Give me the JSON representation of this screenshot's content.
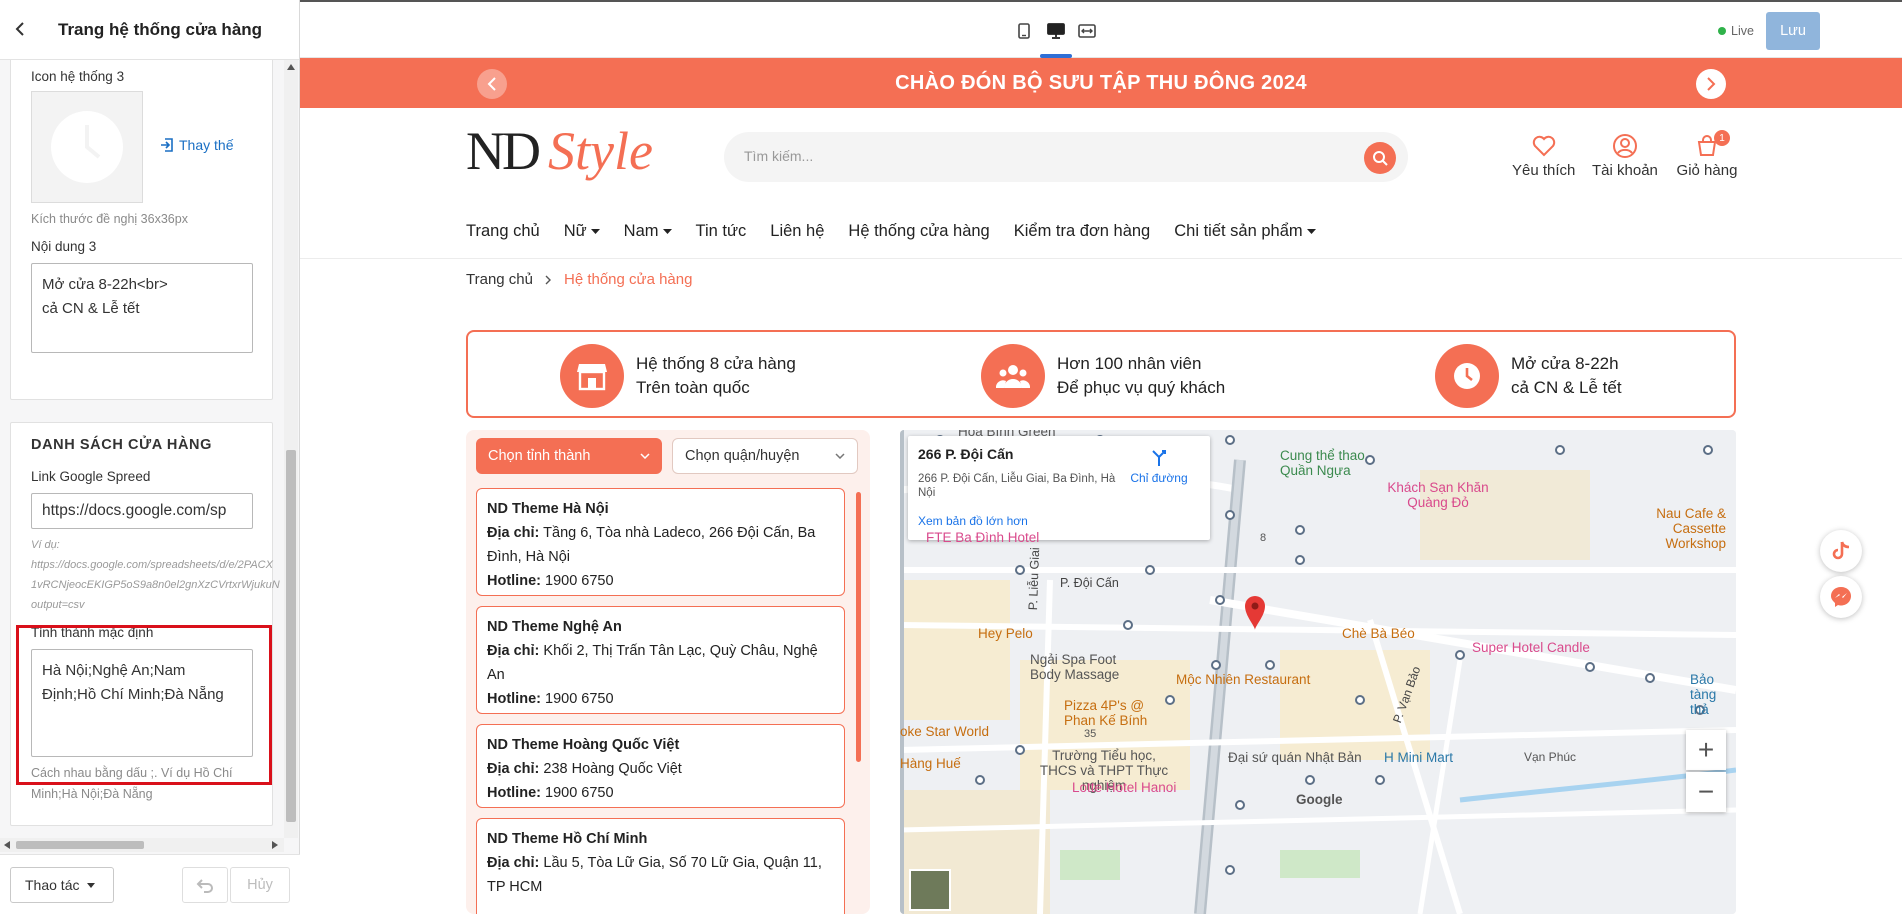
{
  "editor": {
    "title": "Trang hệ thống cửa hàng",
    "icon3_label": "Icon hệ thống 3",
    "replace_label": "Thay thế",
    "icon_size_hint": "Kích thước đề nghị 36x36px",
    "content3_label": "Nội dung 3",
    "content3_value": "Mở cửa 8-22h<br>\ncả CN & Lễ tết",
    "store_list_title": "DANH SÁCH CỬA HÀNG",
    "sheet_link_label": "Link Google Spreed",
    "sheet_link_value": "https://docs.google.com/sp",
    "example_lines": [
      "Ví dụ:",
      "https://docs.google.com/spreadsheets/d/e/2PACX",
      "1vRCNjeocEKIGP5oS9a8n0el2gnXzCVrtxrWjukuN",
      "output=csv"
    ],
    "default_province_label": "Tỉnh thành mặc định",
    "default_province_value": "Hà Nội;Nghệ An;Nam Định;Hồ Chí Minh;Đà Nẵng",
    "default_province_hint": "Cách nhau bằng dấu ;. Ví dụ Hồ Chí Minh;Hà Nội;Đà Nẵng",
    "actions_label": "Thao tác",
    "cancel_label": "Hủy"
  },
  "topbar": {
    "live_label": "Live",
    "save_label": "Lưu"
  },
  "site": {
    "announcement": "CHÀO ĐÓN BỘ SƯU TẬP THU ĐÔNG 2024",
    "logo_nd": "ND",
    "logo_style": "Style",
    "search_placeholder": "Tìm kiếm...",
    "wishlist_label": "Yêu thích",
    "account_label": "Tài khoản",
    "cart_label": "Giỏ hàng",
    "cart_count": "1",
    "nav": [
      {
        "label": "Trang chủ",
        "dropdown": false
      },
      {
        "label": "Nữ",
        "dropdown": true
      },
      {
        "label": "Nam",
        "dropdown": true
      },
      {
        "label": "Tin tức",
        "dropdown": false
      },
      {
        "label": "Liên hệ",
        "dropdown": false
      },
      {
        "label": "Hệ thống cửa hàng",
        "dropdown": false
      },
      {
        "label": "Kiểm tra đơn hàng",
        "dropdown": false
      },
      {
        "label": "Chi tiết sản phẩm",
        "dropdown": true
      }
    ],
    "breadcrumb_home": "Trang chủ",
    "breadcrumb_current": "Hệ thống cửa hàng",
    "features": [
      {
        "line1": "Hệ thống 8 cửa hàng",
        "line2": "Trên toàn quốc"
      },
      {
        "line1": "Hơn 100 nhân viên",
        "line2": "Để phục vụ quý khách"
      },
      {
        "line1": "Mở cửa 8-22h",
        "line2": "cả CN & Lễ tết"
      }
    ],
    "province_select": "Chọn tỉnh thành",
    "district_select": "Chọn quận/huyện",
    "address_label": "Địa chỉ:",
    "hotline_label": "Hotline:",
    "stores": [
      {
        "name": "ND Theme Hà Nội",
        "address": "Tầng 6, Tòa nhà Ladeco, 266 Đội Cấn, Ba Đình, Hà Nội",
        "hotline": "1900 6750"
      },
      {
        "name": "ND Theme Nghệ An",
        "address": "Khối 2, Thị Trấn Tân Lạc, Quỳ Châu, Nghệ An",
        "hotline": "1900 6750"
      },
      {
        "name": "ND Theme Hoàng Quốc Việt",
        "address": "238 Hoàng Quốc Việt",
        "hotline": "1900 6750"
      },
      {
        "name": "ND Theme Hồ Chí Minh",
        "address": "Lầu 5, Tòa Lữ Gia, Số 70 Lữ Gia, Quận 11, TP HCM",
        "hotline": ""
      }
    ],
    "map": {
      "title": "266 P. Đội Cấn",
      "full_address": "266 P. Đội Cấn, Liễu Giai, Ba Đình, Hà Nội",
      "directions": "Chỉ đường",
      "view_larger": "Xem bản đồ lớn hơn",
      "labels": [
        "Hoà Bình Green",
        "Cung thể thao Quần Ngựa",
        "Khách Sạn Khăn Quàng Đỏ",
        "Nau Cafe & Cassette Workshop",
        "FTE Ba Đình Hotel",
        "P. Đội Cấn",
        "P. Liễu Giai",
        "Hey Pelo",
        "Chè Bà Béo",
        "Super Hotel Candle",
        "Bảo tàng thả",
        "Ngải Spa Foot Body Massage",
        "Mộc Nhiên Restaurant",
        "P. Vạn Bảo",
        "Pizza 4P's @ Phan Kế Bính",
        "oke Star World",
        "Hàng Huế",
        "Trường Tiểu học, THCS và THPT Thực nghiệm",
        "Đại sứ quán Nhật Bản",
        "H Mini Mart",
        "Vạn Phúc",
        "Lotte Hotel Hanoi",
        "Google",
        "8",
        "35"
      ],
      "zoom_in": "+",
      "zoom_out": "−"
    }
  },
  "colors": {
    "accent": "#f46f54",
    "save_button": "#90b5dc",
    "live": "#2fb24a",
    "highlight_box": "#d9101a"
  }
}
